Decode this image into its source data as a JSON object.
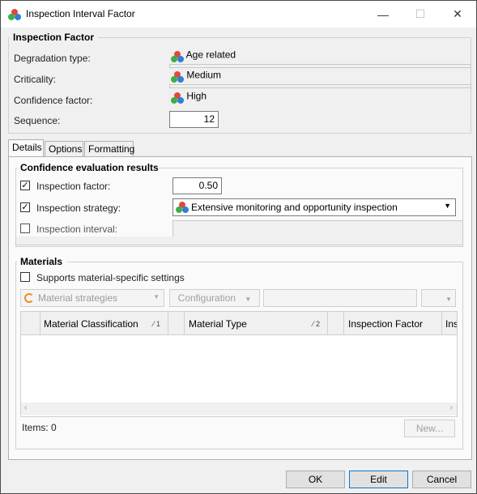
{
  "window": {
    "title": "Inspection Interval Factor",
    "minimize": "—",
    "maximize": "☐",
    "close": "✕"
  },
  "inspection_factor": {
    "group_title": "Inspection Factor",
    "degradation_label": "Degradation type:",
    "degradation_value": "Age related",
    "criticality_label": "Criticality:",
    "criticality_value": "Medium",
    "confidence_label": "Confidence factor:",
    "confidence_value": "High",
    "sequence_label": "Sequence:",
    "sequence_value": "12"
  },
  "tabs": [
    "Details",
    "Options",
    "Formatting"
  ],
  "active_tab": "Details",
  "confidence_results": {
    "group_title": "Confidence evaluation results",
    "inspection_factor_label": "Inspection factor:",
    "inspection_factor_value": "0.50",
    "inspection_factor_checked": true,
    "inspection_strategy_label": "Inspection strategy:",
    "inspection_strategy_value": "Extensive monitoring and opportunity inspection",
    "inspection_strategy_checked": true,
    "inspection_interval_label": "Inspection interval:",
    "inspection_interval_value": "",
    "inspection_interval_checked": false
  },
  "materials": {
    "group_title": "Materials",
    "supports_label": "Supports material-specific settings",
    "supports_checked": false,
    "strategies_dropdown": "Material strategies",
    "configuration_button": "Configuration",
    "columns": [
      {
        "label": "Material Classification",
        "sort": "1"
      },
      {
        "label": "Material Type",
        "sort": "2"
      },
      {
        "label": "Inspection Factor",
        "sort": ""
      },
      {
        "label": "Ins",
        "sort": ""
      }
    ],
    "items_label": "Items: 0",
    "new_button": "New..."
  },
  "footer": {
    "ok": "OK",
    "edit": "Edit",
    "cancel": "Cancel"
  },
  "colors": {
    "accent": "#0078d7",
    "icon_red": "#e04a3a",
    "icon_green": "#3fae49",
    "icon_blue": "#2f7fd6"
  }
}
